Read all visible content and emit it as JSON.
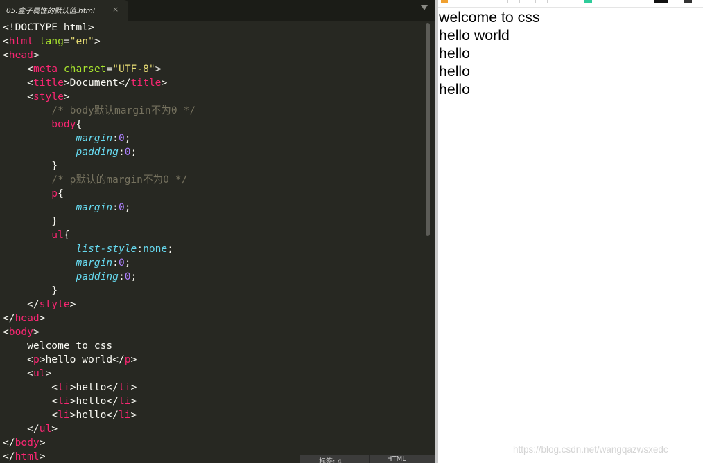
{
  "editor": {
    "tab": {
      "label": "05.盒子属性的默认值.html",
      "close": "×"
    },
    "status": {
      "tabs": "标签: 4",
      "syntax": "HTML"
    },
    "code": [
      [
        [
          "t-text",
          "<!DOCTYPE html>"
        ]
      ],
      [
        [
          "t-text",
          "<"
        ],
        [
          "t-tag",
          "html"
        ],
        [
          "t-text",
          " "
        ],
        [
          "t-attr",
          "lang"
        ],
        [
          "t-text",
          "="
        ],
        [
          "t-str",
          "\"en\""
        ],
        [
          "t-text",
          ">"
        ]
      ],
      [
        [
          "t-text",
          "<"
        ],
        [
          "t-tag",
          "head"
        ],
        [
          "t-text",
          ">"
        ]
      ],
      [
        [
          "t-text",
          "    <"
        ],
        [
          "t-tag",
          "meta"
        ],
        [
          "t-text",
          " "
        ],
        [
          "t-attr",
          "charset"
        ],
        [
          "t-text",
          "="
        ],
        [
          "t-str",
          "\"UTF-8\""
        ],
        [
          "t-text",
          ">"
        ]
      ],
      [
        [
          "t-text",
          "    <"
        ],
        [
          "t-tag",
          "title"
        ],
        [
          "t-text",
          ">Document</"
        ],
        [
          "t-tag",
          "title"
        ],
        [
          "t-text",
          ">"
        ]
      ],
      [
        [
          "t-text",
          "    <"
        ],
        [
          "t-tag",
          "style"
        ],
        [
          "t-text",
          ">"
        ]
      ],
      [
        [
          "t-text",
          "        "
        ],
        [
          "t-comment",
          "/* body默认margin不为0 */"
        ]
      ],
      [
        [
          "t-text",
          "        "
        ],
        [
          "t-tag",
          "body"
        ],
        [
          "t-text",
          "{"
        ]
      ],
      [
        [
          "t-text",
          "            "
        ],
        [
          "t-prop",
          "margin"
        ],
        [
          "t-text",
          ":"
        ],
        [
          "t-num",
          "0"
        ],
        [
          "t-text",
          ";"
        ]
      ],
      [
        [
          "t-text",
          "            "
        ],
        [
          "t-prop",
          "padding"
        ],
        [
          "t-text",
          ":"
        ],
        [
          "t-num",
          "0"
        ],
        [
          "t-text",
          ";"
        ]
      ],
      [
        [
          "t-text",
          "        }"
        ]
      ],
      [
        [
          "t-text",
          "        "
        ],
        [
          "t-comment",
          "/* p默认的margin不为0 */"
        ]
      ],
      [
        [
          "t-text",
          "        "
        ],
        [
          "t-tag",
          "p"
        ],
        [
          "t-text",
          "{"
        ]
      ],
      [
        [
          "t-text",
          "            "
        ],
        [
          "t-prop",
          "margin"
        ],
        [
          "t-text",
          ":"
        ],
        [
          "t-num",
          "0"
        ],
        [
          "t-text",
          ";"
        ]
      ],
      [
        [
          "t-text",
          "        }"
        ]
      ],
      [
        [
          "t-text",
          "        "
        ],
        [
          "t-tag",
          "ul"
        ],
        [
          "t-text",
          "{"
        ]
      ],
      [
        [
          "t-text",
          "            "
        ],
        [
          "t-prop",
          "list-style"
        ],
        [
          "t-text",
          ":"
        ],
        [
          "t-val",
          "none"
        ],
        [
          "t-text",
          ";"
        ]
      ],
      [
        [
          "t-text",
          "            "
        ],
        [
          "t-prop",
          "margin"
        ],
        [
          "t-text",
          ":"
        ],
        [
          "t-num",
          "0"
        ],
        [
          "t-text",
          ";"
        ]
      ],
      [
        [
          "t-text",
          "            "
        ],
        [
          "t-prop",
          "padding"
        ],
        [
          "t-text",
          ":"
        ],
        [
          "t-num",
          "0"
        ],
        [
          "t-text",
          ";"
        ]
      ],
      [
        [
          "t-text",
          "        }"
        ]
      ],
      [
        [
          "t-text",
          "    </"
        ],
        [
          "t-tag",
          "style"
        ],
        [
          "t-text",
          ">"
        ]
      ],
      [
        [
          "t-text",
          "</"
        ],
        [
          "t-tag",
          "head"
        ],
        [
          "t-text",
          ">"
        ]
      ],
      [
        [
          "t-text",
          "<"
        ],
        [
          "t-tag",
          "body"
        ],
        [
          "t-text",
          ">"
        ]
      ],
      [
        [
          "t-text",
          "    welcome to css"
        ]
      ],
      [
        [
          "t-text",
          "    <"
        ],
        [
          "t-tag",
          "p"
        ],
        [
          "t-text",
          ">hello world</"
        ],
        [
          "t-tag",
          "p"
        ],
        [
          "t-text",
          ">"
        ]
      ],
      [
        [
          "t-text",
          "    <"
        ],
        [
          "t-tag",
          "ul"
        ],
        [
          "t-text",
          ">"
        ]
      ],
      [
        [
          "t-text",
          "        <"
        ],
        [
          "t-tag",
          "li"
        ],
        [
          "t-text",
          ">hello</"
        ],
        [
          "t-tag",
          "li"
        ],
        [
          "t-text",
          ">"
        ]
      ],
      [
        [
          "t-text",
          "        <"
        ],
        [
          "t-tag",
          "li"
        ],
        [
          "t-text",
          ">hello</"
        ],
        [
          "t-tag",
          "li"
        ],
        [
          "t-text",
          ">"
        ]
      ],
      [
        [
          "t-text",
          "        <"
        ],
        [
          "t-tag",
          "li"
        ],
        [
          "t-text",
          ">hello</"
        ],
        [
          "t-tag",
          "li"
        ],
        [
          "t-text",
          ">"
        ]
      ],
      [
        [
          "t-text",
          "    </"
        ],
        [
          "t-tag",
          "ul"
        ],
        [
          "t-text",
          ">"
        ]
      ],
      [
        [
          "t-text",
          "</"
        ],
        [
          "t-tag",
          "body"
        ],
        [
          "t-text",
          ">"
        ]
      ],
      [
        [
          "t-text",
          "</"
        ],
        [
          "t-tag",
          "html"
        ],
        [
          "t-text",
          ">"
        ]
      ]
    ]
  },
  "preview": {
    "lines": [
      "welcome to css",
      "hello world",
      "hello",
      "hello",
      "hello"
    ],
    "watermark": "https://blog.csdn.net/wangqazwsxedc"
  },
  "colors": {
    "editor_bg": "#272822",
    "tag": "#f92672",
    "attr": "#a6e22e",
    "string": "#e6db74",
    "comment": "#75715e",
    "property": "#66d9ef",
    "number": "#ae81ff"
  }
}
